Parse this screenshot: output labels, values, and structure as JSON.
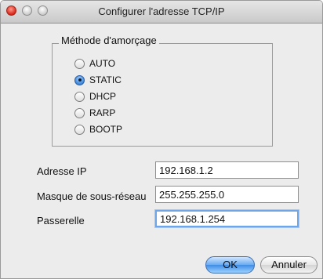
{
  "window": {
    "title": "Configurer l'adresse TCP/IP"
  },
  "boot_method": {
    "label": "Méthode d'amorçage",
    "options": [
      "AUTO",
      "STATIC",
      "DHCP",
      "RARP",
      "BOOTP"
    ],
    "selected": "STATIC"
  },
  "fields": {
    "ip_label": "Adresse IP",
    "ip_value": "192.168.1.2",
    "mask_label": "Masque de sous-réseau",
    "mask_value": "255.255.255.0",
    "gateway_label": "Passerelle",
    "gateway_value": "192.168.1.254"
  },
  "buttons": {
    "ok_label": "OK",
    "cancel_label": "Annuler"
  },
  "colors": {
    "window_bg": "#ececec",
    "default_button_blue": "#3f8de6",
    "focus_ring": "#6fa6ea"
  }
}
